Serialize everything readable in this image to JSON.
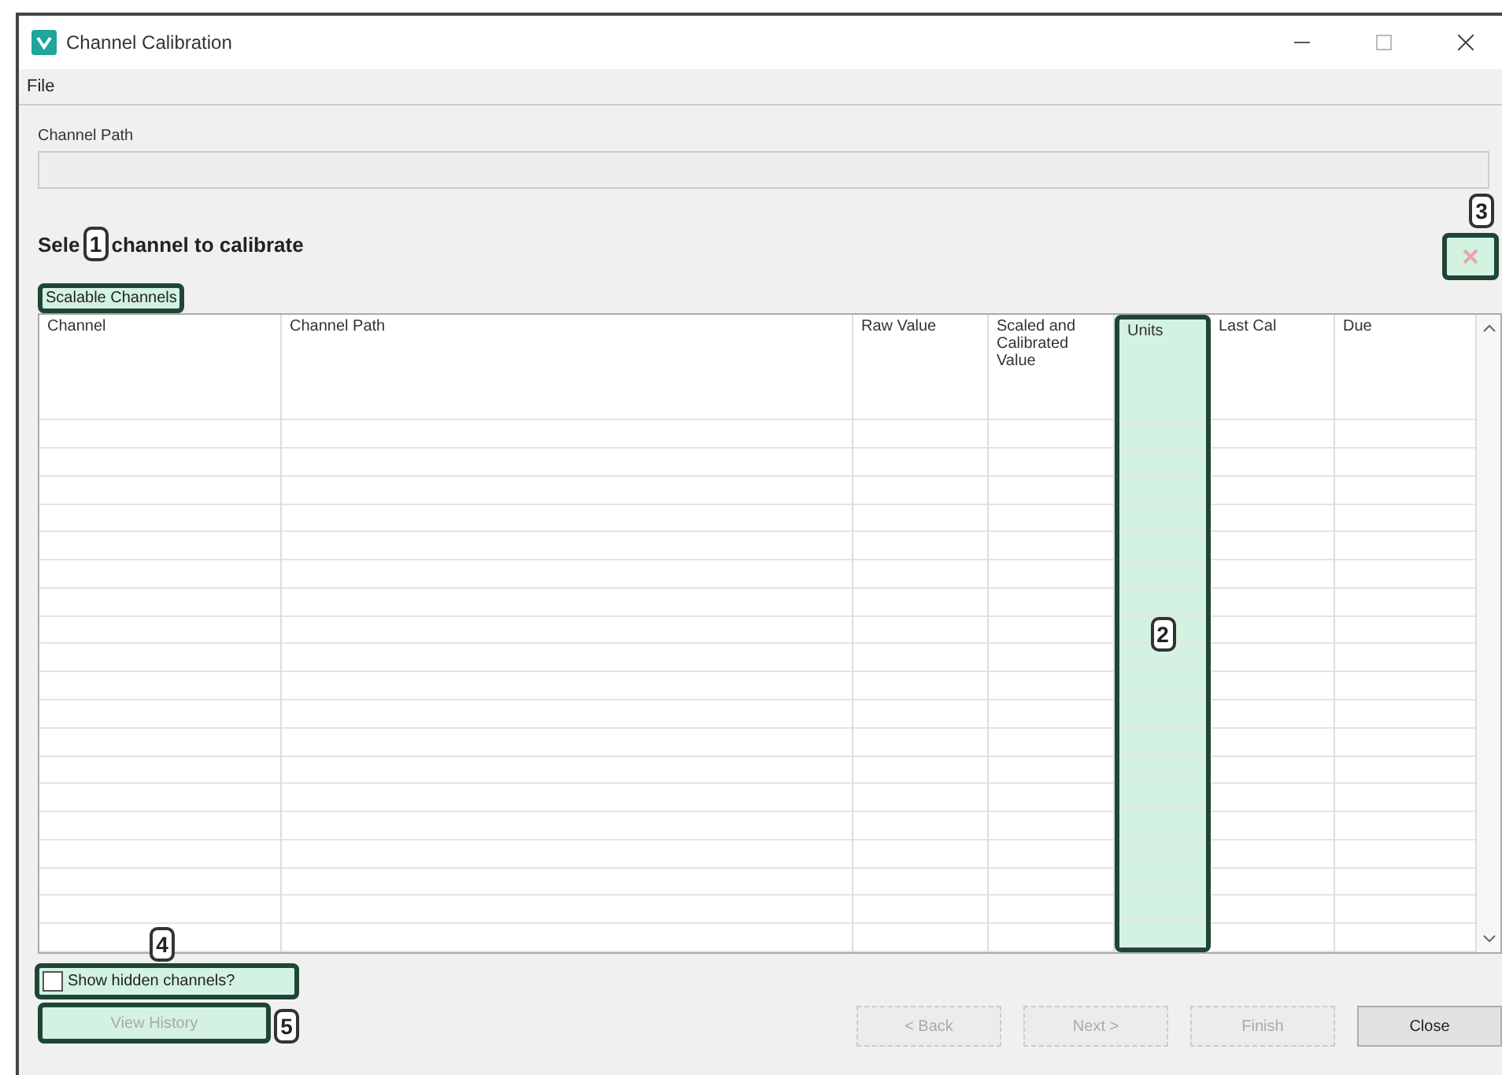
{
  "window": {
    "title": "Channel Calibration"
  },
  "menu": [
    "File"
  ],
  "channel_path": {
    "label": "Channel Path"
  },
  "heading": {
    "text_before": "Sele",
    "callout": "1",
    "text_after": "channel to calibrate"
  },
  "group": {
    "label": "Scalable Channels",
    "highlighted": true
  },
  "delete_button": {
    "disabled": true,
    "highlighted": true,
    "callout": "3"
  },
  "table": {
    "columns": [
      {
        "label": "Channel",
        "highlighted": false
      },
      {
        "label": "Channel Path",
        "highlighted": false
      },
      {
        "label": "Raw Value",
        "highlighted": false
      },
      {
        "label": "Scaled and Calibrated Value",
        "highlighted": false
      },
      {
        "label": "Units",
        "highlighted": true,
        "callout": "2"
      },
      {
        "label": "Last Cal",
        "highlighted": false
      },
      {
        "label": "Due",
        "highlighted": false
      }
    ]
  },
  "show_hidden": {
    "label": "Show hidden channels?",
    "checked": false,
    "highlighted": true,
    "callout": "4"
  },
  "view_history": {
    "label": "View History",
    "disabled": true,
    "highlighted": true,
    "callout": "5"
  },
  "buttons": [
    {
      "label": "< Back",
      "disabled": true
    },
    {
      "label": "Next >",
      "disabled": true
    },
    {
      "label": "Finish",
      "disabled": true
    },
    {
      "label": "Close",
      "disabled": false
    }
  ]
}
